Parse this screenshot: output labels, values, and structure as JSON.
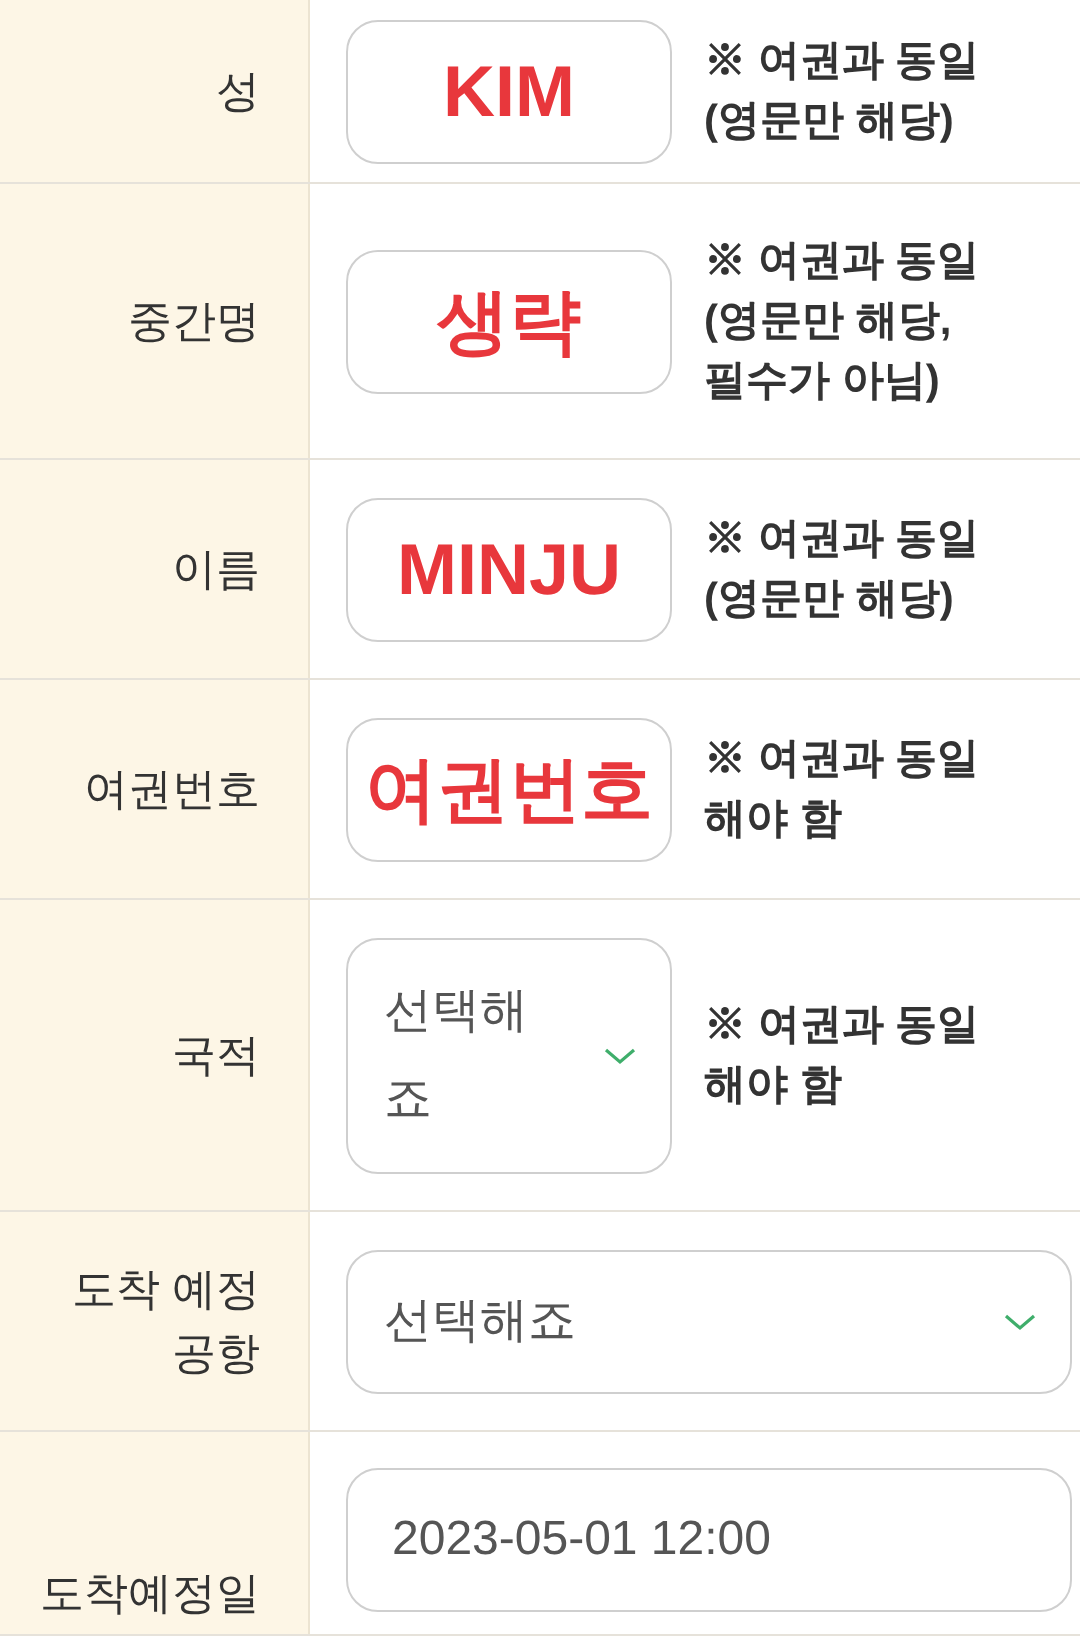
{
  "rows": [
    {
      "label": [
        "성"
      ],
      "field": {
        "kind": "marked",
        "value": "KIM"
      },
      "note": [
        "※ 여권과 동일",
        "(영문만 해당)"
      ]
    },
    {
      "label": [
        "중간명"
      ],
      "field": {
        "kind": "marked",
        "value": "생략"
      },
      "note": [
        "※ 여권과 동일",
        "(영문만 해당,",
        "필수가 아님)"
      ]
    },
    {
      "label": [
        "이름"
      ],
      "field": {
        "kind": "marked",
        "value": "MINJU"
      },
      "note": [
        "※ 여권과 동일",
        "(영문만 해당)"
      ]
    },
    {
      "label": [
        "여권번호"
      ],
      "field": {
        "kind": "marked",
        "value": "여권번호"
      },
      "note": [
        "※ 여권과 동일",
        "해야 함"
      ]
    },
    {
      "label": [
        "국적"
      ],
      "field": {
        "kind": "select",
        "value": "선택해죠"
      },
      "note": [
        "※ 여권과 동일",
        "해야 함"
      ]
    },
    {
      "label": [
        "도착 예정",
        "공항"
      ],
      "field": {
        "kind": "select-wide",
        "value": "선택해죠"
      },
      "note": []
    },
    {
      "label": [
        "도착예정일"
      ],
      "field": {
        "kind": "text-wide",
        "value": "2023-05-01 12:00"
      },
      "note": []
    }
  ]
}
